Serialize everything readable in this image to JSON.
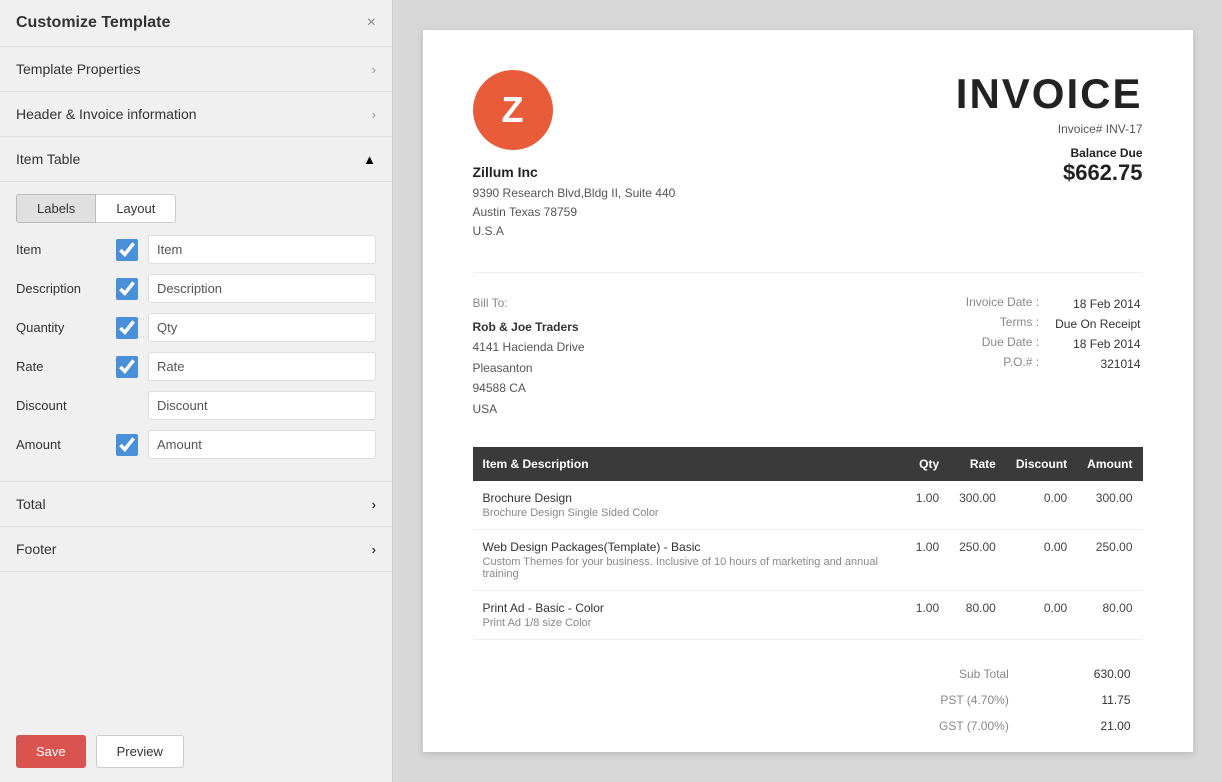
{
  "panel": {
    "title": "Customize Template",
    "close_label": "×"
  },
  "sections": {
    "template_properties": {
      "label": "Template Properties"
    },
    "header_invoice": {
      "label": "Header & Invoice information"
    },
    "item_table": {
      "label": "Item Table"
    },
    "total": {
      "label": "Total"
    },
    "footer": {
      "label": "Footer"
    }
  },
  "tabs": {
    "labels": "Labels",
    "layout": "Layout"
  },
  "fields": [
    {
      "name": "Item",
      "checked": true,
      "value": "Item",
      "has_checkbox": true
    },
    {
      "name": "Description",
      "checked": true,
      "value": "Description",
      "has_checkbox": true
    },
    {
      "name": "Quantity",
      "checked": true,
      "value": "Qty",
      "has_checkbox": true
    },
    {
      "name": "Rate",
      "checked": true,
      "value": "Rate",
      "has_checkbox": true
    },
    {
      "name": "Discount",
      "checked": false,
      "value": "Discount",
      "has_checkbox": false
    },
    {
      "name": "Amount",
      "checked": true,
      "value": "Amount",
      "has_checkbox": true
    }
  ],
  "buttons": {
    "save": "Save",
    "preview": "Preview"
  },
  "invoice": {
    "company_logo_letter": "Z",
    "company_name": "Zillum Inc",
    "company_address_line1": "9390 Research Blvd,Bldg II, Suite 440",
    "company_address_line2": "Austin Texas 78759",
    "company_address_line3": "U.S.A",
    "title": "INVOICE",
    "invoice_number_label": "Invoice# INV-17",
    "balance_due_label": "Balance Due",
    "balance_due_amount": "$662.75",
    "bill_to_label": "Bill To:",
    "client_name": "Rob & Joe Traders",
    "client_address1": "4141 Hacienda Drive",
    "client_address2": "Pleasanton",
    "client_address3": "94588 CA",
    "client_address4": "USA",
    "invoice_date_label": "Invoice Date :",
    "invoice_date_value": "18 Feb 2014",
    "terms_label": "Terms :",
    "terms_value": "Due On Receipt",
    "due_date_label": "Due Date :",
    "due_date_value": "18 Feb 2014",
    "po_label": "P.O.# :",
    "po_value": "321014",
    "table_headers": {
      "item": "Item & Description",
      "qty": "Qty",
      "rate": "Rate",
      "discount": "Discount",
      "amount": "Amount"
    },
    "line_items": [
      {
        "name": "Brochure Design",
        "desc": "Brochure Design Single Sided Color",
        "qty": "1.00",
        "rate": "300.00",
        "discount": "0.00",
        "amount": "300.00"
      },
      {
        "name": "Web Design Packages(Template) - Basic",
        "desc": "Custom Themes for your business. Inclusive of 10 hours of marketing and annual training",
        "qty": "1.00",
        "rate": "250.00",
        "discount": "0.00",
        "amount": "250.00"
      },
      {
        "name": "Print Ad - Basic - Color",
        "desc": "Print Ad 1/8 size Color",
        "qty": "1.00",
        "rate": "80.00",
        "discount": "0.00",
        "amount": "80.00"
      }
    ],
    "subtotal_label": "Sub Total",
    "subtotal_value": "630.00",
    "pst_label": "PST (4.70%)",
    "pst_value": "11.75",
    "gst_label": "GST (7.00%)",
    "gst_value": "21.00"
  }
}
